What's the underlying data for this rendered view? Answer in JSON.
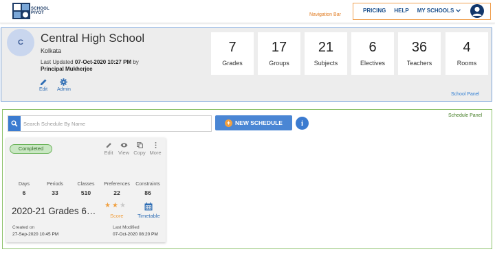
{
  "brand": {
    "line1": "SCHOOL",
    "line2": "PIVOT"
  },
  "annotations": {
    "navigation_bar": "Navigation Bar",
    "school_panel": "School Panel",
    "schedule_panel": "Schedule Panel"
  },
  "nav": {
    "pricing": "PRICING",
    "help": "HELP",
    "my_schools": "MY SCHOOLS",
    "account_icon": "account-circle-icon"
  },
  "school": {
    "avatar_letter": "C",
    "name": "Central High School",
    "city": "Kolkata",
    "updated_prefix": "Last Updated",
    "updated_at": "07-Oct-2020 10:27 PM",
    "updated_by_prefix": "by",
    "updated_by": "Principal Mukherjee",
    "actions": {
      "edit": "Edit",
      "admin": "Admin"
    },
    "stats": [
      {
        "value": "7",
        "label": "Grades"
      },
      {
        "value": "17",
        "label": "Groups"
      },
      {
        "value": "21",
        "label": "Subjects"
      },
      {
        "value": "6",
        "label": "Electives"
      },
      {
        "value": "36",
        "label": "Teachers"
      },
      {
        "value": "4",
        "label": "Rooms"
      }
    ]
  },
  "schedule": {
    "search_placeholder": "Search Schedule By Name",
    "new_button": "NEW SCHEDULE",
    "info_glyph": "i",
    "card": {
      "status": "Completed",
      "actions": {
        "edit": "Edit",
        "view": "View",
        "copy": "Copy",
        "more": "More"
      },
      "metrics": [
        {
          "label": "Days",
          "value": "6"
        },
        {
          "label": "Periods",
          "value": "33"
        },
        {
          "label": "Classes",
          "value": "510"
        },
        {
          "label": "Preferences",
          "value": "22"
        },
        {
          "label": "Constraints",
          "value": "86"
        }
      ],
      "title": "2020-21 Grades 6…",
      "score": {
        "label": "Score",
        "stars_filled": 2,
        "stars_total": 3
      },
      "timetable_label": "Timetable",
      "created_label": "Created on",
      "created_value": "27-Sep-2020 10:45 PM",
      "modified_label": "Last Modified",
      "modified_value": "07-Oct-2020 08:20 PM"
    }
  },
  "colors": {
    "accent": "#3b7bd0",
    "navy": "#12376b",
    "orange": "#f0a040",
    "success": "#6bb35a"
  }
}
